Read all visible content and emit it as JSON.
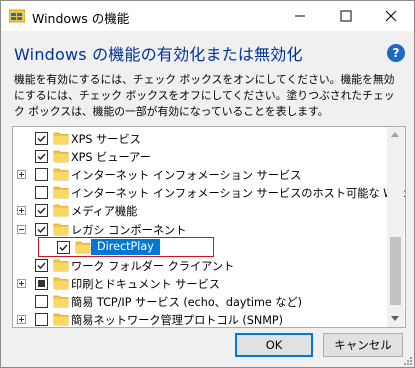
{
  "window": {
    "title": "Windows の機能",
    "minimize_icon": "minimize-icon",
    "maximize_icon": "maximize-icon",
    "close_icon": "close-icon"
  },
  "heading": "Windows の機能の有効化または無効化",
  "help_label": "?",
  "description": "機能を有効にするには、チェック ボックスをオンにしてください。機能を無効にするには、チェック ボックスをオフにしてください。塗りつぶされたチェック ボックスは、機能の一部が有効になっていることを表します。",
  "features": [
    {
      "label": "XPS サービス",
      "state": "checked",
      "expandable": false,
      "level": 0
    },
    {
      "label": "XPS ビューアー",
      "state": "checked",
      "expandable": false,
      "level": 0
    },
    {
      "label": "インターネット インフォメーション サービス",
      "state": "unchecked",
      "expandable": true,
      "level": 0
    },
    {
      "label": "インターネット インフォメーション サービスのホスト可能な Web コア",
      "state": "unchecked",
      "expandable": false,
      "level": 0
    },
    {
      "label": "メディア機能",
      "state": "checked",
      "expandable": true,
      "level": 0
    },
    {
      "label": "レガシ コンポーネント",
      "state": "checked",
      "expandable": true,
      "expanded": true,
      "level": 0
    },
    {
      "label": "DirectPlay",
      "state": "checked",
      "expandable": false,
      "level": 1,
      "selected": true
    },
    {
      "label": "ワーク フォルダー クライアント",
      "state": "checked",
      "expandable": false,
      "level": 0
    },
    {
      "label": "印刷とドキュメント サービス",
      "state": "partial",
      "expandable": true,
      "level": 0
    },
    {
      "label": "簡易 TCP/IP サービス (echo、daytime など)",
      "state": "unchecked",
      "expandable": false,
      "level": 0
    },
    {
      "label": "簡易ネットワーク管理プロトコル (SNMP)",
      "state": "unchecked",
      "expandable": true,
      "level": 0
    }
  ],
  "buttons": {
    "ok": "OK",
    "cancel": "キャンセル"
  },
  "colors": {
    "heading": "#003399",
    "selection": "#0078d7",
    "highlight_border": "#d0141e",
    "folder": "#f3c63f"
  }
}
